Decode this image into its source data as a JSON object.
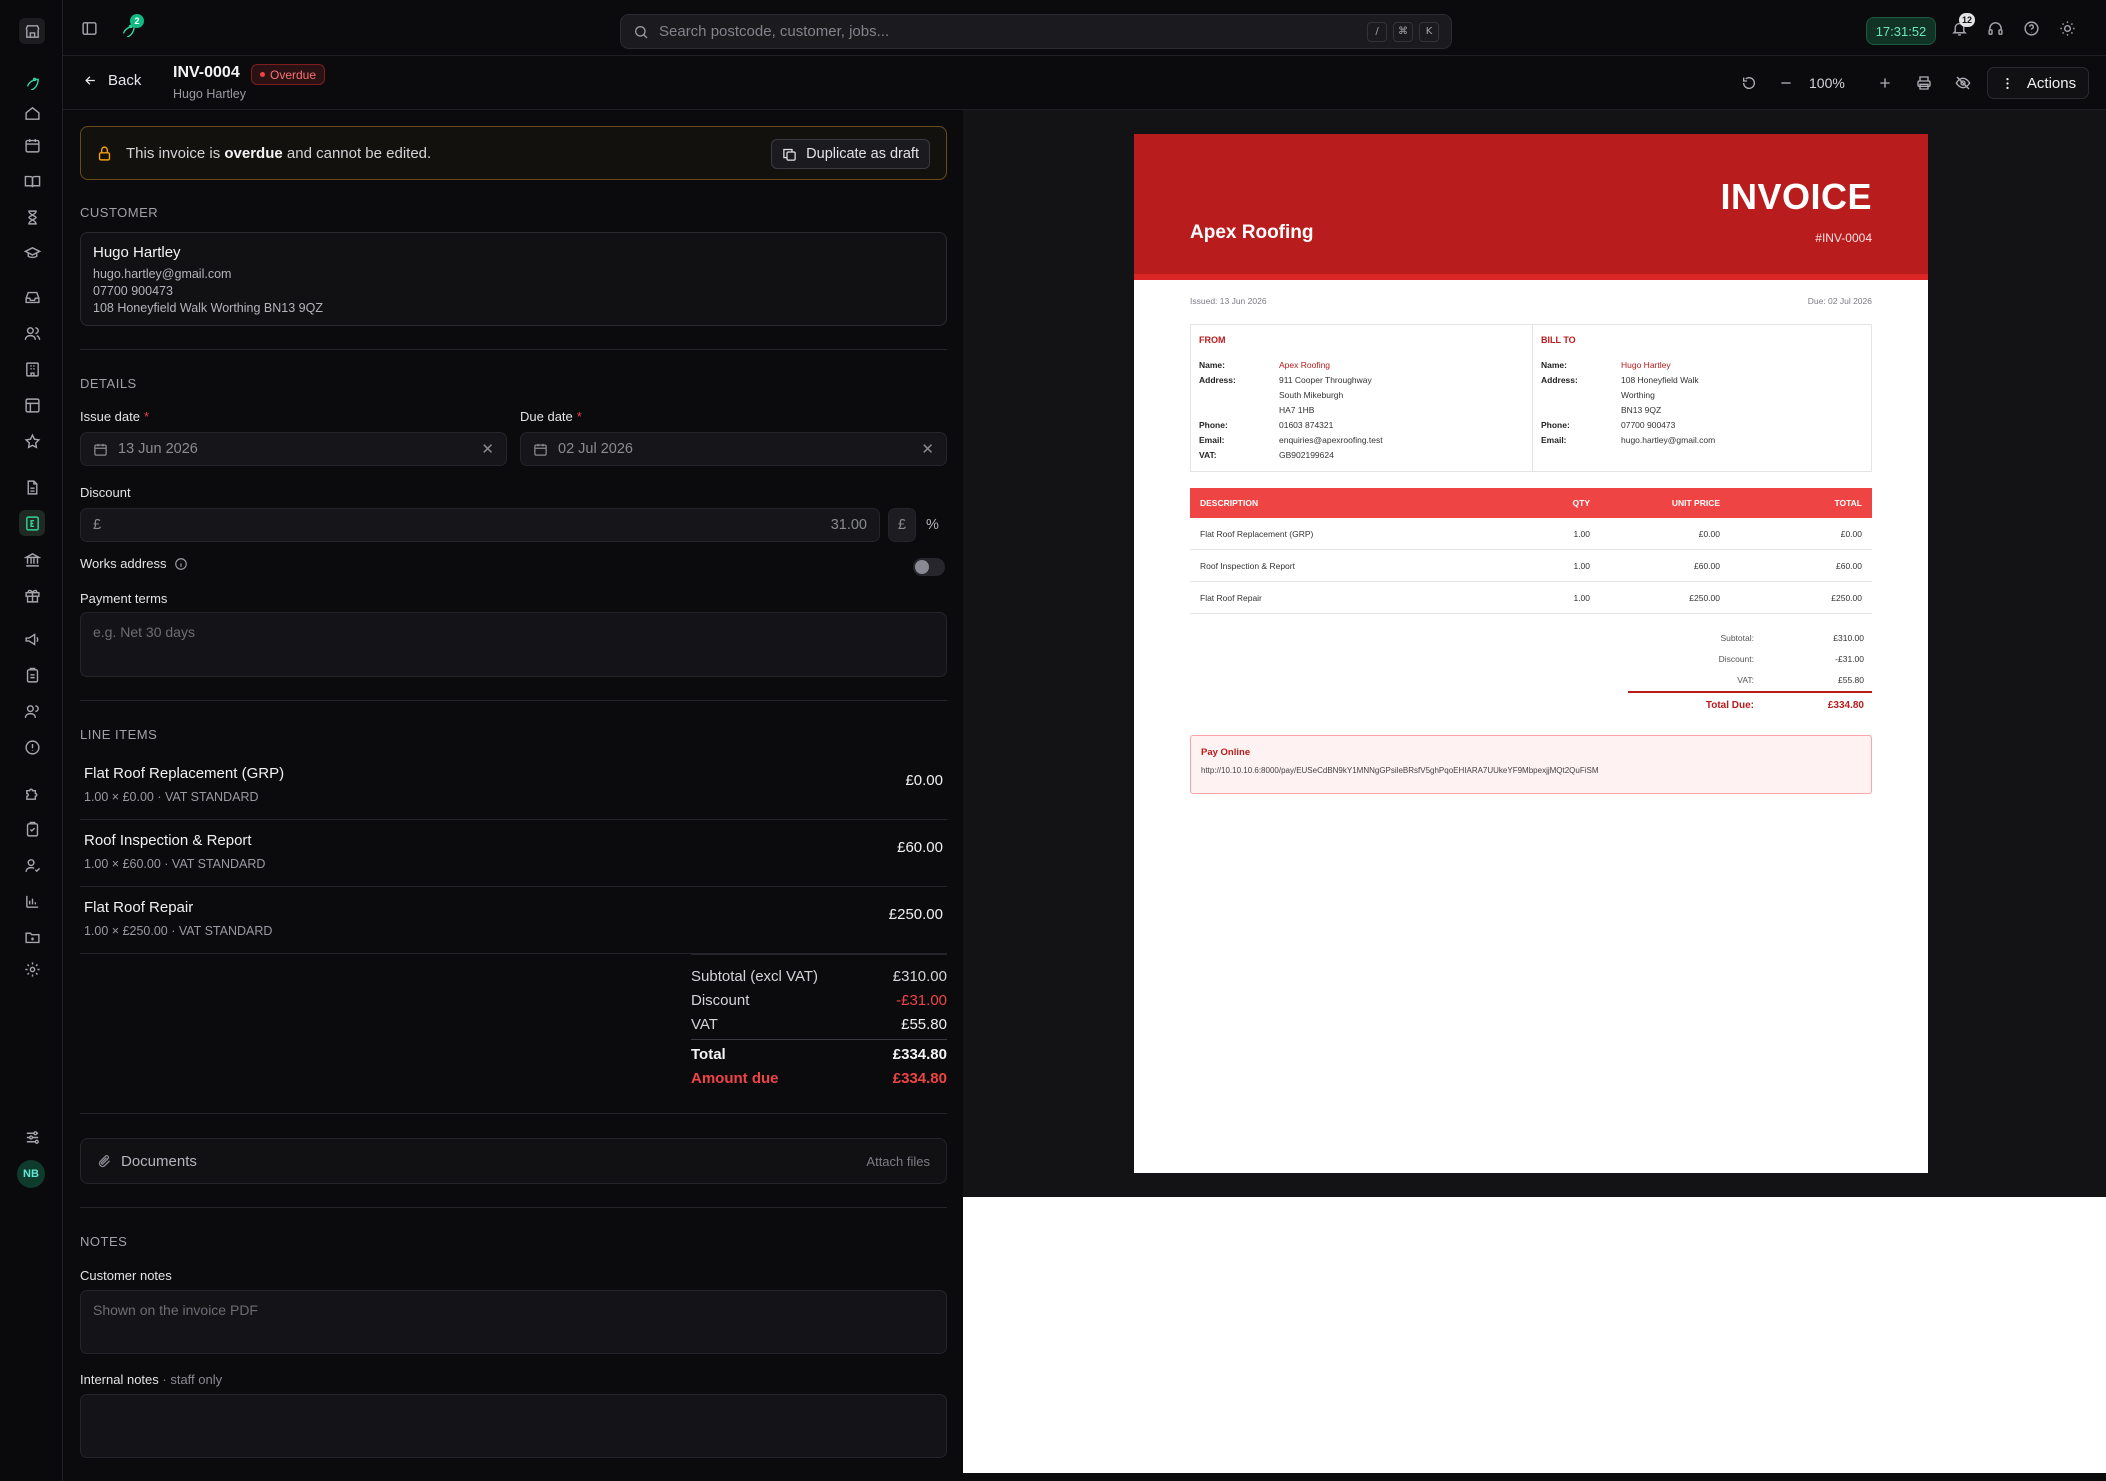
{
  "topbar": {
    "notify_badge": "2",
    "search_placeholder": "Search postcode, customer, jobs...",
    "kbd_slash": "/",
    "kbd_cmd": "⌘",
    "kbd_k": "K",
    "clock": "17:31:52",
    "bell_badge": "12"
  },
  "header": {
    "back_label": "Back",
    "invoice_number": "INV-0004",
    "status": "Overdue",
    "customer": "Hugo Hartley",
    "zoom": "100%",
    "actions_label": "Actions"
  },
  "banner": {
    "text_before": "This invoice is",
    "text_bold": "overdue",
    "text_after": "and cannot be edited.",
    "duplicate_label": "Duplicate as draft"
  },
  "customer": {
    "section_title": "CUSTOMER",
    "name": "Hugo Hartley",
    "email": "hugo.hartley@gmail.com",
    "phone": "07700 900473",
    "address": "108 Honeyfield Walk Worthing BN13 9QZ"
  },
  "details": {
    "section_title": "DETAILS",
    "issue_label": "Issue date",
    "issue_value": "13 Jun 2026",
    "due_label": "Due date",
    "due_value": "02 Jul 2026",
    "discount_label": "Discount",
    "discount_currency": "£",
    "discount_value": "31.00",
    "discount_unit_pound": "£",
    "discount_unit_percent": "%",
    "works_address_label": "Works address",
    "payment_terms_label": "Payment terms",
    "payment_terms_placeholder": "e.g. Net 30 days"
  },
  "line_items": {
    "section_title": "LINE ITEMS",
    "items": [
      {
        "name": "Flat Roof Replacement (GRP)",
        "detail": "1.00 × £0.00 · VAT STANDARD",
        "price": "£0.00"
      },
      {
        "name": "Roof Inspection & Report",
        "detail": "1.00 × £60.00 · VAT STANDARD",
        "price": "£60.00"
      },
      {
        "name": "Flat Roof Repair",
        "detail": "1.00 × £250.00 · VAT STANDARD",
        "price": "£250.00"
      }
    ]
  },
  "totals": {
    "subtotal_label": "Subtotal (excl VAT)",
    "subtotal": "£310.00",
    "discount_label": "Discount",
    "discount": "-£31.00",
    "vat_label": "VAT",
    "vat": "£55.80",
    "total_label": "Total",
    "total": "£334.80",
    "due_label": "Amount due",
    "due": "£334.80"
  },
  "documents": {
    "label": "Documents",
    "attach_label": "Attach files"
  },
  "notes": {
    "section_title": "NOTES",
    "customer_label": "Customer notes",
    "customer_placeholder": "Shown on the invoice PDF",
    "internal_label": "Internal notes",
    "internal_sub": " · staff only"
  },
  "preview": {
    "company": "Apex Roofing",
    "title": "INVOICE",
    "number": "#INV-0004",
    "issued": "Issued: 13 Jun 2026",
    "due": "Due: 02 Jul 2026",
    "from": {
      "heading": "FROM",
      "name_k": "Name:",
      "name": "Apex Roofing",
      "address_k": "Address:",
      "address1": "911 Cooper Throughway",
      "address2": "South Mikeburgh",
      "address3": "HA7 1HB",
      "phone_k": "Phone:",
      "phone": "01603 874321",
      "email_k": "Email:",
      "email": "enquiries@apexroofing.test",
      "vat_k": "VAT:",
      "vat": "GB902199624"
    },
    "bill_to": {
      "heading": "BILL TO",
      "name_k": "Name:",
      "name": "Hugo Hartley",
      "address_k": "Address:",
      "address1": "108 Honeyfield Walk",
      "address2": "Worthing",
      "address3": "BN13 9QZ",
      "phone_k": "Phone:",
      "phone": "07700 900473",
      "email_k": "Email:",
      "email": "hugo.hartley@gmail.com"
    },
    "table": {
      "headers": [
        "DESCRIPTION",
        "QTY",
        "UNIT PRICE",
        "TOTAL"
      ],
      "rows": [
        [
          "Flat Roof Replacement (GRP)",
          "1.00",
          "£0.00",
          "£0.00"
        ],
        [
          "Roof Inspection & Report",
          "1.00",
          "£60.00",
          "£60.00"
        ],
        [
          "Flat Roof Repair",
          "1.00",
          "£250.00",
          "£250.00"
        ]
      ]
    },
    "summary": {
      "subtotal_k": "Subtotal:",
      "subtotal": "£310.00",
      "discount_k": "Discount:",
      "discount": "-£31.00",
      "vat_k": "VAT:",
      "vat": "£55.80",
      "total_k": "Total Due:",
      "total": "£334.80"
    },
    "pay": {
      "heading": "Pay Online",
      "url": "http://10.10.10.6:8000/pay/EUSeCdBN9kY1MNNgGPsileBRsfV5ghPqoEHIARA7UUkeYF9MbpexjjMQt2QuFiSM"
    }
  },
  "sidebar": {
    "avatar_initials": "NB"
  },
  "colors": {
    "accent": "#34d399",
    "danger": "#ef4444",
    "invoice_red": "#b91c1c"
  }
}
